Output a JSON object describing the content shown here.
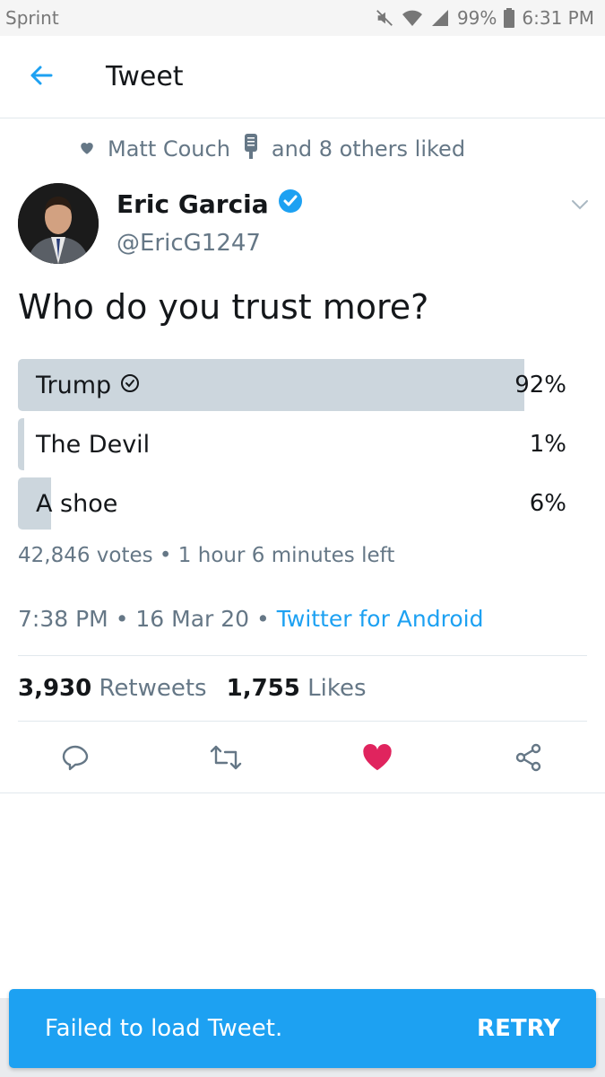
{
  "status_bar": {
    "carrier": "Sprint",
    "battery": "99%",
    "time": "6:31 PM"
  },
  "header": {
    "title": "Tweet"
  },
  "social_context": {
    "text_user": "Matt Couch",
    "text_rest": "and 8 others liked"
  },
  "author": {
    "name": "Eric Garcia",
    "handle": "@EricG1247"
  },
  "tweet": {
    "text": "Who do you trust more?"
  },
  "poll": {
    "options": [
      {
        "label": "Trump",
        "percent_label": "92%",
        "value": 0.92,
        "winner": true
      },
      {
        "label": "The Devil",
        "percent_label": "1%",
        "value": 0.01,
        "winner": false
      },
      {
        "label": "A shoe",
        "percent_label": "6%",
        "value": 0.06,
        "winner": false
      }
    ],
    "meta": "42,846 votes • 1 hour 6 minutes left"
  },
  "timestamp": {
    "time": "7:38 PM",
    "date": "16 Mar 20",
    "source": "Twitter for Android"
  },
  "stats": {
    "retweets_count": "3,930",
    "retweets_label": "Retweets",
    "likes_count": "1,755",
    "likes_label": "Likes"
  },
  "actions": {
    "reply": "reply-icon",
    "retweet": "retweet-icon",
    "like": "heart-icon",
    "share": "share-icon",
    "like_color": "#e0245e"
  },
  "toast": {
    "message": "Failed to load Tweet.",
    "action": "RETRY"
  },
  "colors": {
    "accent": "#1da1f2",
    "muted": "#657786",
    "poll_fill": "#ccd6dd"
  }
}
